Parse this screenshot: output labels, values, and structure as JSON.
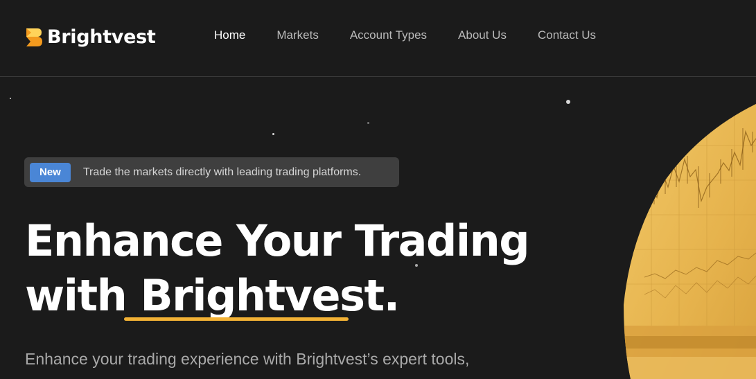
{
  "brand": {
    "name": "Brightvest",
    "accent_color": "#f3b235",
    "logo_colors": [
      "#f39a1e",
      "#ffd35a"
    ]
  },
  "nav": {
    "items": [
      {
        "label": "Home",
        "active": true
      },
      {
        "label": "Markets",
        "active": false
      },
      {
        "label": "Account Types",
        "active": false
      },
      {
        "label": "About Us",
        "active": false
      },
      {
        "label": "Contact Us",
        "active": false
      }
    ]
  },
  "announcement": {
    "badge": "New",
    "text": "Trade the markets directly with leading trading platforms.",
    "badge_color": "#4a86d6"
  },
  "hero": {
    "title_line1": "Enhance Your Trading",
    "title_line2_prefix": "with ",
    "title_brand": "Brightvest",
    "title_suffix": ".",
    "subtitle": "Enhance your trading experience with Brightvest’s expert tools,"
  },
  "hero_image": {
    "icon": "trading-chart-image",
    "tint": "#e8b54a"
  }
}
